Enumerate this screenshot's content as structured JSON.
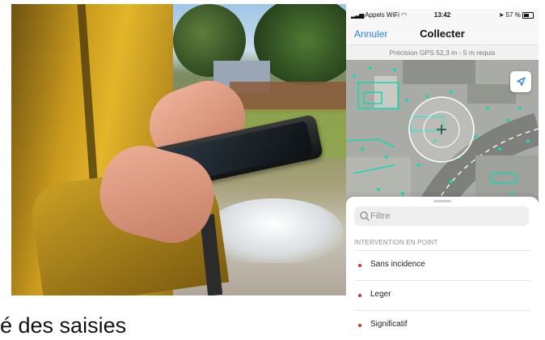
{
  "caption": {
    "text": "é des saisies"
  },
  "phone": {
    "status_bar": {
      "carrier": "Appels WiFi",
      "time": "13:42",
      "battery": "57 %"
    },
    "nav": {
      "cancel_label": "Annuler",
      "title": "Collecter"
    },
    "gps_precision": "Précision GPS 52,3 m - 5 m requis",
    "search": {
      "placeholder": "Filtre"
    },
    "section_header": "INTERVENTION EN POINT",
    "list_items": [
      {
        "label": "Sans incidence"
      },
      {
        "label": "Leger"
      },
      {
        "label": "Significatif"
      }
    ],
    "colors": {
      "accent": "#2a7de1",
      "map_features": "#1fd4b0",
      "item_dot": "#d62b2b"
    }
  }
}
